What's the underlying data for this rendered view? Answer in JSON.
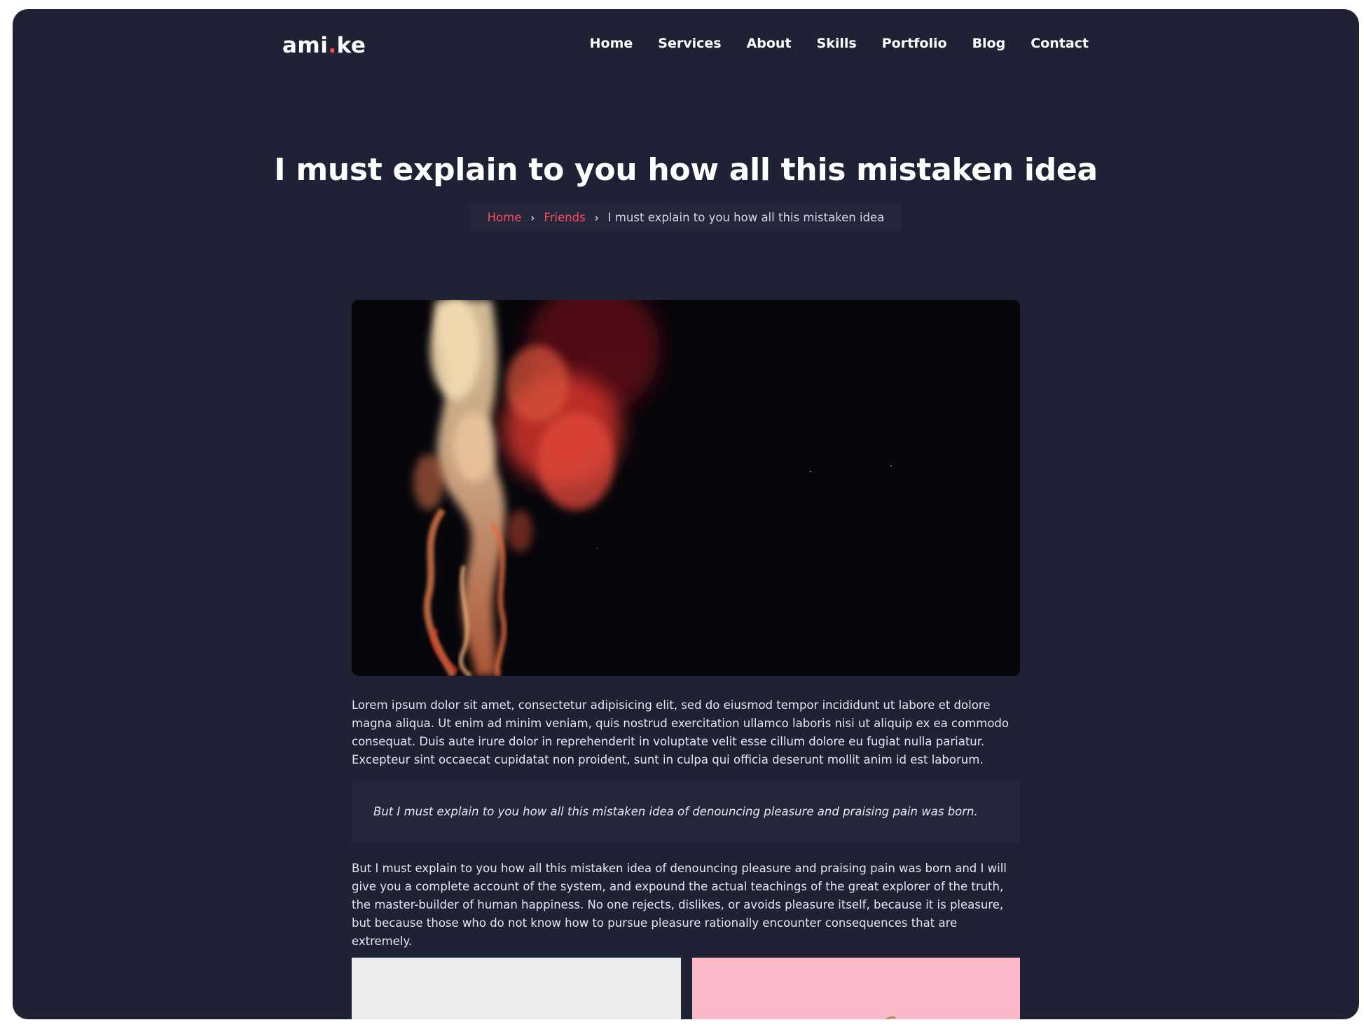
{
  "header": {
    "logo_main": "ami",
    "logo_dot": ".",
    "logo_tail": "ke",
    "nav": [
      "Home",
      "Services",
      "About",
      "Skills",
      "Portfolio",
      "Blog",
      "Contact"
    ]
  },
  "post": {
    "title": "I must explain to you how all this mistaken idea",
    "breadcrumb": {
      "home": "Home",
      "category": "Friends",
      "current": "I must explain to you how all this mistaken idea"
    },
    "paragraph_1": "Lorem ipsum dolor sit amet, consectetur adipisicing elit, sed do eiusmod tempor incididunt ut labore et dolore magna aliqua. Ut enim ad minim veniam, quis nostrud exercitation ullamco laboris nisi ut aliquip ex ea commodo consequat. Duis aute irure dolor in reprehenderit in voluptate velit esse cillum dolore eu fugiat nulla pariatur. Excepteur sint occaecat cupidatat non proident, sunt in culpa qui officia deserunt mollit anim id est laborum.",
    "quote": "But I must explain to you how all this mistaken idea of denouncing pleasure and praising pain was born.",
    "paragraph_2": "But I must explain to you how all this mistaken idea of denouncing pleasure and praising pain was born and I will give you a complete account of the system, and expound the actual teachings of the great explorer of the truth, the master-builder of human happiness. No one rejects, dislikes, or avoids pleasure itself, because it is pleasure, but because those who do not know how to pursue pleasure rationally encounter consequences that are extremely."
  },
  "colors": {
    "background": "#1f2235",
    "accent": "#ff4a57",
    "panel": "#24273b"
  }
}
